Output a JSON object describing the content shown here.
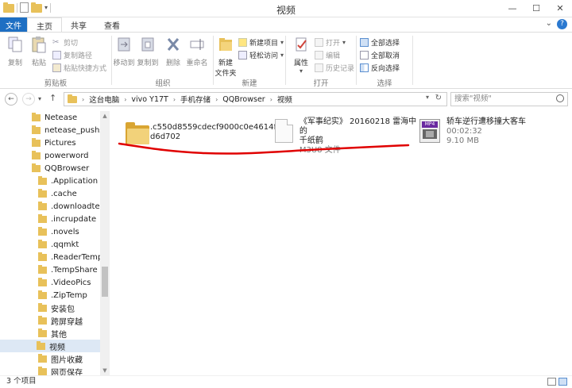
{
  "window": {
    "title": "视频"
  },
  "tabs": [
    "文件",
    "主页",
    "共享",
    "查看"
  ],
  "ribbon": {
    "clipboard": {
      "label": "剪贴板",
      "copy": "复制",
      "paste": "粘贴",
      "cut": "剪切",
      "copy_path": "复制路径",
      "paste_shortcut": "粘贴快捷方式"
    },
    "organize": {
      "label": "组织",
      "move_to": "移动到",
      "copy_to": "复制到",
      "delete": "删除",
      "rename": "重命名"
    },
    "new": {
      "label": "新建",
      "new_folder": "新建\n文件夹",
      "new_item": "新建项目",
      "easy_access": "轻松访问"
    },
    "open": {
      "label": "打开",
      "properties": "属性",
      "open": "打开",
      "edit": "编辑",
      "history": "历史记录"
    },
    "select": {
      "label": "选择",
      "select_all": "全部选择",
      "select_none": "全部取消",
      "invert": "反向选择"
    }
  },
  "address": {
    "segments": [
      "这台电脑",
      "vivo Y17T",
      "手机存储",
      "QQBrowser",
      "视频"
    ]
  },
  "search": {
    "placeholder": "搜索\"视频\""
  },
  "sidebar": {
    "items": [
      {
        "label": "Netease",
        "indent": 0
      },
      {
        "label": "netease_pushservice",
        "indent": 0
      },
      {
        "label": "Pictures",
        "indent": 0
      },
      {
        "label": "powerword",
        "indent": 0
      },
      {
        "label": "QQBrowser",
        "indent": 0
      },
      {
        "label": ".Application",
        "indent": 1
      },
      {
        "label": ".cache",
        "indent": 1
      },
      {
        "label": ".downloadtemp",
        "indent": 1
      },
      {
        "label": ".incrupdate",
        "indent": 1
      },
      {
        "label": ".novels",
        "indent": 1
      },
      {
        "label": ".qqmkt",
        "indent": 1
      },
      {
        "label": ".ReaderTemp",
        "indent": 1
      },
      {
        "label": ".TempShare",
        "indent": 1
      },
      {
        "label": ".VideoPics",
        "indent": 1
      },
      {
        "label": ".ZipTemp",
        "indent": 1
      },
      {
        "label": "安装包",
        "indent": 1
      },
      {
        "label": "跨屏穿越",
        "indent": 1
      },
      {
        "label": "其他",
        "indent": 1
      },
      {
        "label": "视频",
        "indent": 1,
        "selected": true
      },
      {
        "label": "图片收藏",
        "indent": 1
      },
      {
        "label": "网页保存",
        "indent": 1
      }
    ]
  },
  "files": [
    {
      "name_line1": ".c550d8559cdecf9000c0e4614f",
      "name_line2": "d6d702",
      "meta1": "",
      "meta2": "",
      "type": "folder"
    },
    {
      "name_line1": "《军事纪实》 20160218 雷海中的",
      "name_line2": "千纸鹤",
      "meta1": "M3U8 文件",
      "meta2": "",
      "type": "m3u8"
    },
    {
      "name_line1": "轿车逆行遭移撞大客车",
      "name_line2": "",
      "meta1": "00:02:32",
      "meta2": "9.10 MB",
      "type": "mp4"
    }
  ],
  "status": {
    "count": "3 个项目"
  },
  "colors": {
    "accent": "#1e6fc3",
    "annotation": "#e00000"
  }
}
